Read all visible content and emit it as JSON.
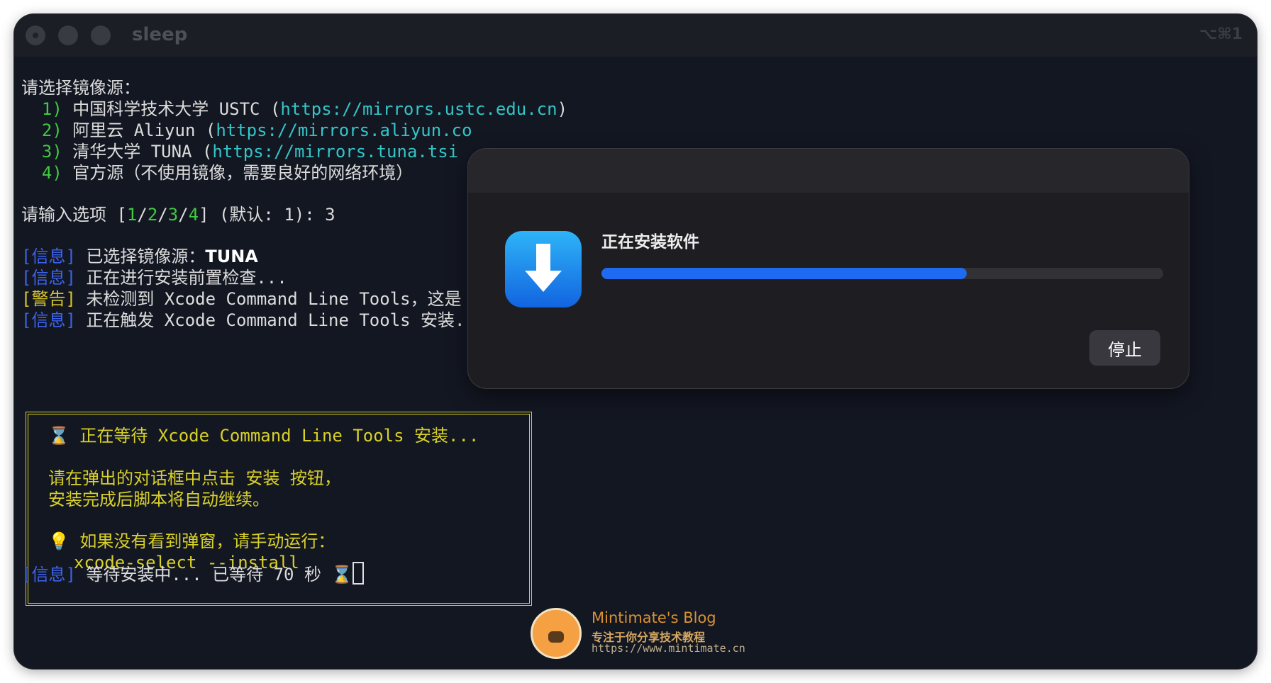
{
  "window": {
    "title": "sleep",
    "shortcut": "⌥⌘1"
  },
  "terminal": {
    "prompt_label": "请选择镜像源：",
    "mirrors": [
      {
        "num": "1)",
        "text": "中国科学技术大学 USTC (",
        "url": "https://mirrors.ustc.edu.cn",
        "close": ")"
      },
      {
        "num": "2)",
        "text": "阿里云 Aliyun (",
        "url": "https://mirrors.aliyun.co"
      },
      {
        "num": "3)",
        "text": "清华大学 TUNA (",
        "url": "https://mirrors.tuna.tsi"
      },
      {
        "num": "4)",
        "text": "官方源（不使用镜像，需要良好的网络环境）"
      }
    ],
    "input_line": {
      "prefix": "请输入选项 [",
      "options": [
        "1",
        "2",
        "3",
        "4"
      ],
      "sep": "/",
      "suffix": "] (默认: 1): 3"
    },
    "log": [
      {
        "tag": "[信息]",
        "text": "已选择镜像源：",
        "bold": "TUNA"
      },
      {
        "tag": "[信息]",
        "text": "正在进行安装前置检查..."
      },
      {
        "tag": "[警告]",
        "text": "未检测到 Xcode Command Line Tools，这是"
      },
      {
        "tag": "[信息]",
        "text": "正在触发 Xcode Command Line Tools 安装..."
      }
    ],
    "box": {
      "waiting_icon": "⌛",
      "waiting": "正在等待 Xcode Command Line Tools 安装...",
      "instruction1": "请在弹出的对话框中点击 安装 按钮，",
      "instruction2": "安装完成后脚本将自动继续。",
      "hint_icon": "💡",
      "hint": "如果没有看到弹窗，请手动运行：",
      "command": "xcode-select --install"
    },
    "last_line": {
      "tag": "[信息]",
      "text": "等待安装中... 已等待 70 秒",
      "icon": "⌛"
    }
  },
  "dialog": {
    "icon": "download-arrow-icon",
    "title": "正在安装软件",
    "progress": 0.65,
    "stop_label": "停止"
  },
  "watermark": {
    "name": "Mintimate's Blog",
    "tagline": "专注于你分享技术教程",
    "url": "https://www.mintimate.cn"
  },
  "colors": {
    "background": "#131722",
    "green": "#3fcb3f",
    "cyan": "#35c5c8",
    "blue_tag": "#3d63ea",
    "yellow": "#d8d02a",
    "progress": "#1e6af0"
  }
}
